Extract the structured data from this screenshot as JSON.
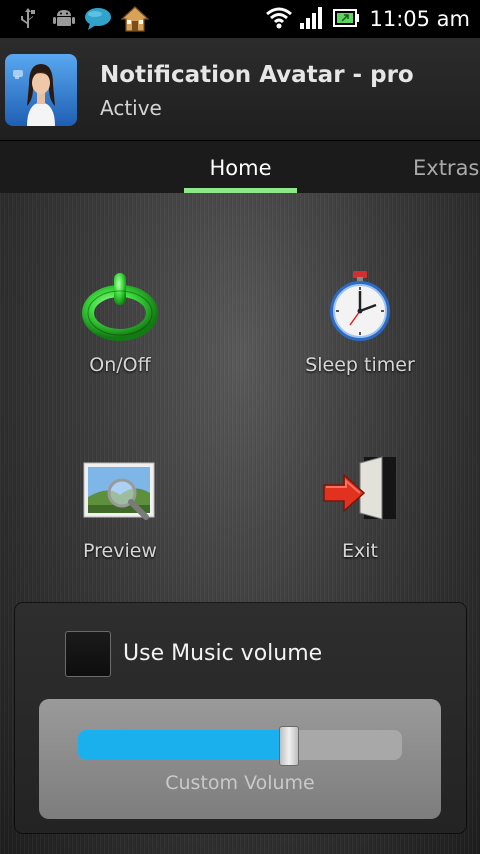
{
  "status_bar": {
    "time": "11:05 am",
    "left_icons": [
      "usb-icon",
      "android-debug-icon",
      "chat-icon",
      "home-icon"
    ],
    "right_icons": [
      "wifi-icon",
      "signal-icon",
      "battery-icon"
    ]
  },
  "app_header": {
    "title": "Notification Avatar - pro",
    "status": "Active",
    "avatar_icon": "avatar-icon"
  },
  "tabs": [
    {
      "label": "Home",
      "selected": true
    },
    {
      "label": "Extras",
      "selected": false
    }
  ],
  "actions": [
    {
      "label": "On/Off",
      "icon": "power-icon"
    },
    {
      "label": "Sleep timer",
      "icon": "stopwatch-icon"
    },
    {
      "label": "Preview",
      "icon": "preview-icon"
    },
    {
      "label": "Exit",
      "icon": "exit-icon"
    }
  ],
  "settings": {
    "music_volume_label": "Use Music volume",
    "music_volume_checked": false,
    "volume_label": "Custom Volume",
    "volume_level": 0.65
  },
  "colors": {
    "tab_indicator": "#8ee88a",
    "slider_fill": "#1ab0ee",
    "power_green": "#3ddc3d"
  }
}
